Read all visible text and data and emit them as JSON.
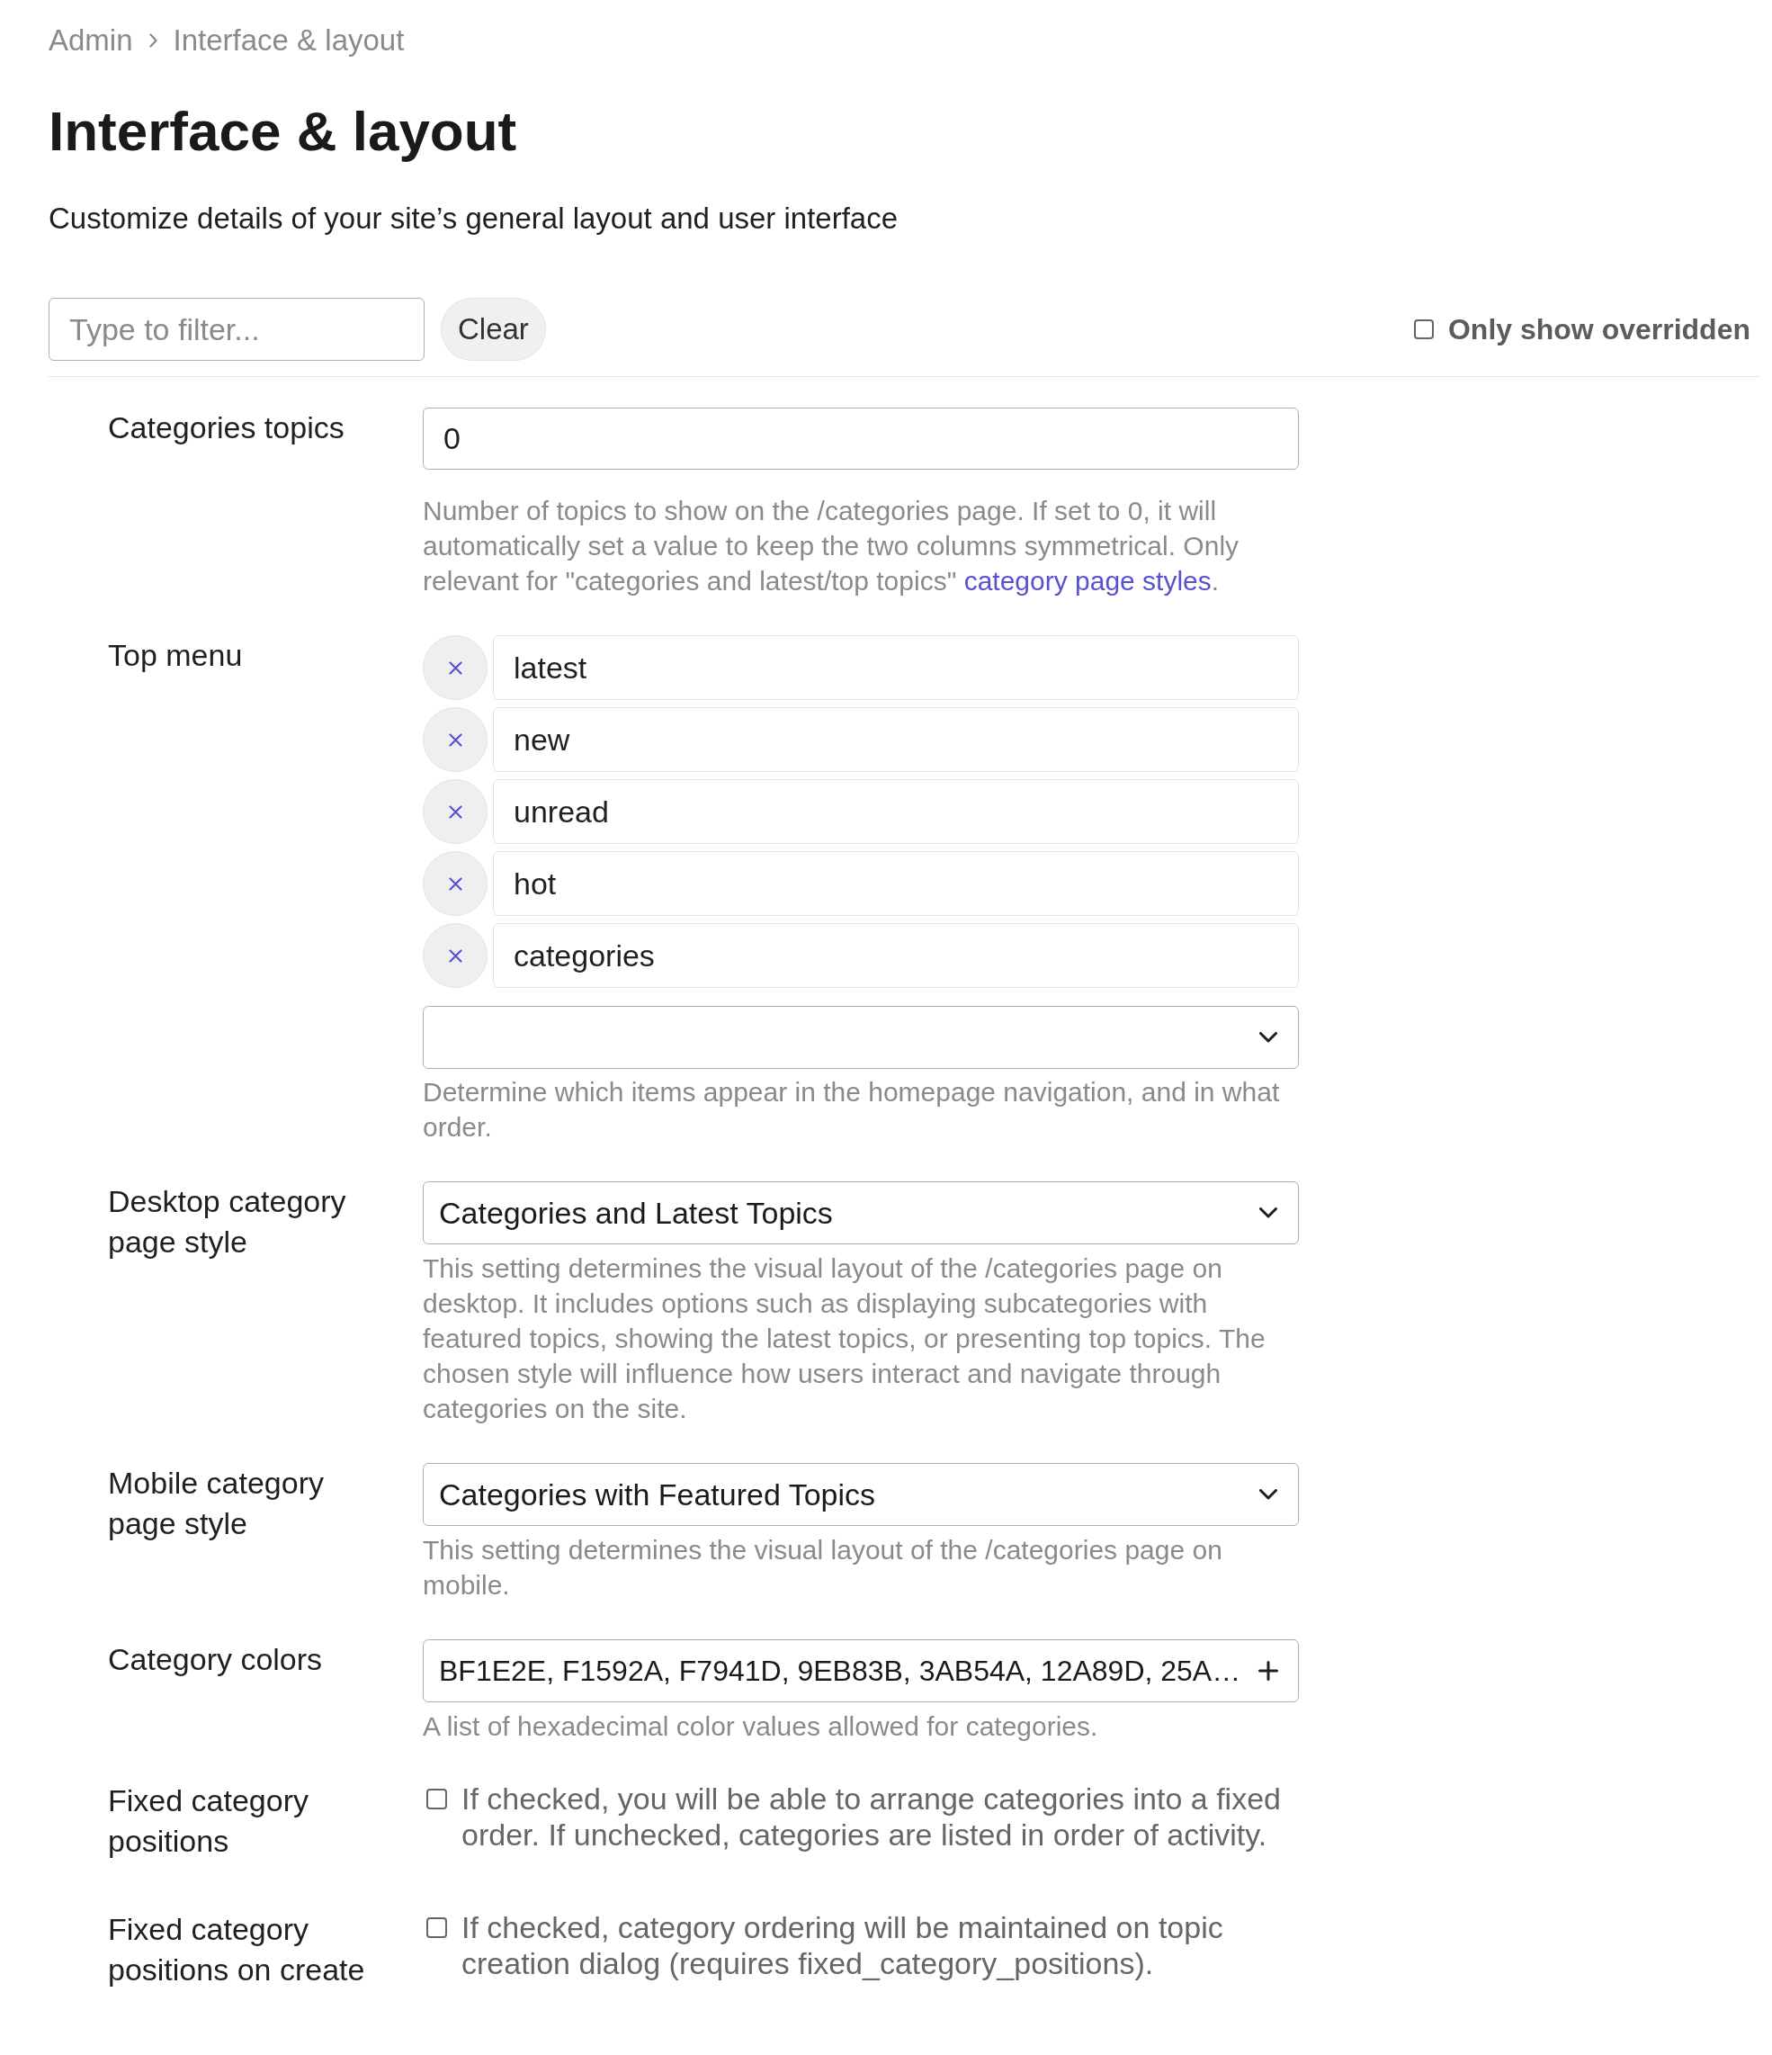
{
  "breadcrumb": [
    {
      "label": "Admin"
    },
    {
      "label": "Interface & layout"
    }
  ],
  "title": "Interface & layout",
  "subtitle": "Customize details of your site’s general layout and user interface",
  "filter": {
    "placeholder": "Type to filter...",
    "clear_button": "Clear",
    "only_overridden": {
      "label": "Only show overridden",
      "checked": false
    }
  },
  "settings": [
    {
      "kind": "text",
      "label": "Categories topics",
      "value": "0",
      "description": [
        {
          "kind": "text",
          "text": "Number of topics to show on the /categories page. If set to 0, it will automatically set a value to keep the two columns symmetrical. Only relevant for \"categories and latest/top topics\" "
        },
        {
          "kind": "link",
          "text": "category page styles"
        },
        {
          "kind": "text",
          "text": "."
        }
      ]
    },
    {
      "kind": "list",
      "label": "Top menu",
      "items": [
        "latest",
        "new",
        "unread",
        "hot",
        "categories"
      ],
      "description": [
        {
          "kind": "text",
          "text": "Determine which items appear in the homepage navigation, and in what order."
        }
      ]
    },
    {
      "kind": "select",
      "label": "Desktop category page style",
      "value": "Categories and Latest Topics",
      "description": [
        {
          "kind": "text",
          "text": "This setting determines the visual layout of the /categories page on desktop. It includes options such as displaying subcategories with featured topics, showing the latest topics, or presenting top topics. The chosen style will influence how users interact and navigate through categories on the site."
        }
      ]
    },
    {
      "kind": "select",
      "label": "Mobile category page style",
      "value": "Categories with Featured Topics",
      "description": [
        {
          "kind": "text",
          "text": "This setting determines the visual layout of the /categories page on mobile."
        }
      ]
    },
    {
      "kind": "color_list",
      "label": "Category colors",
      "value": "BF1E2E, F1592A, F7941D, 9EB83B, 3AB54A, 12A89D, 25A…",
      "description": [
        {
          "kind": "text",
          "text": "A list of hexadecimal color values allowed for categories."
        }
      ]
    },
    {
      "kind": "checkbox",
      "label": "Fixed category positions",
      "checked": false,
      "description": [
        {
          "kind": "text",
          "text": "If checked, you will be able to arrange categories into a fixed order. If unchecked, categories are listed in order of activity."
        }
      ]
    },
    {
      "kind": "checkbox",
      "label": "Fixed category positions on create",
      "checked": false,
      "description": [
        {
          "kind": "text",
          "text": "If checked, category ordering will be maintained on topic creation dialog (requires fixed_category_positions)."
        }
      ]
    }
  ]
}
